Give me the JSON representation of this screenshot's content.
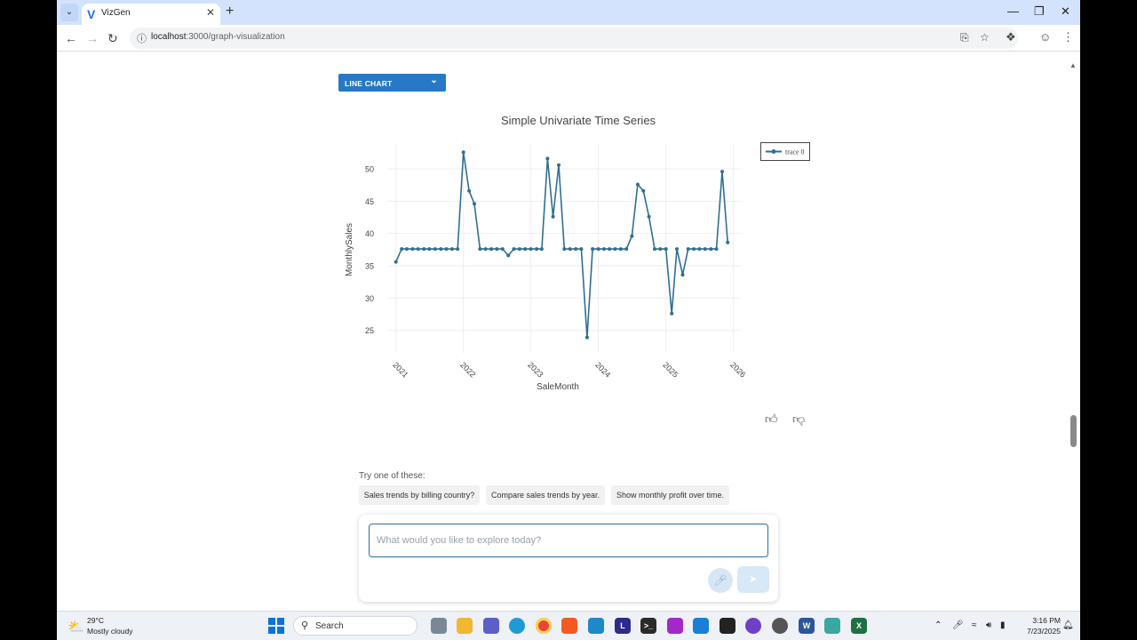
{
  "browser": {
    "tab_title": "VizGen",
    "tab_favicon": "V",
    "url_host": "localhost",
    "url_path": ":3000/graph-visualization"
  },
  "page": {
    "chart_selector_label": "LINE CHART",
    "suggestions_title": "Try one of these:",
    "suggestions": [
      "Sales trends by billing country?",
      "Compare sales trends by year.",
      "Show monthly profit over time."
    ],
    "query_placeholder": "What would you like to explore today?"
  },
  "colors": {
    "accent": "#2779c6",
    "series": "#2f6f92"
  },
  "chart_data": {
    "type": "line",
    "title": "Simple Univariate Time Series",
    "xlabel": "SaleMonth",
    "ylabel": "MonthlySales",
    "x_ticks": [
      "2021",
      "2022",
      "2023",
      "2024",
      "2025",
      "2026"
    ],
    "y_ticks": [
      25,
      30,
      35,
      40,
      45,
      50
    ],
    "ylim": [
      21.5,
      54
    ],
    "xlim": [
      "2020-11-20",
      "2026-02-10"
    ],
    "grid": true,
    "legend_position": "top-right",
    "series": [
      {
        "name": "trace 0",
        "x": [
          "2021-01",
          "2021-02",
          "2021-03",
          "2021-04",
          "2021-05",
          "2021-06",
          "2021-07",
          "2021-08",
          "2021-09",
          "2021-10",
          "2021-11",
          "2021-12",
          "2022-01",
          "2022-02",
          "2022-03",
          "2022-04",
          "2022-05",
          "2022-06",
          "2022-07",
          "2022-08",
          "2022-09",
          "2022-10",
          "2022-11",
          "2022-12",
          "2023-01",
          "2023-02",
          "2023-03",
          "2023-04",
          "2023-05",
          "2023-06",
          "2023-07",
          "2023-08",
          "2023-09",
          "2023-10",
          "2023-11",
          "2023-12",
          "2024-01",
          "2024-02",
          "2024-03",
          "2024-04",
          "2024-05",
          "2024-06",
          "2024-07",
          "2024-08",
          "2024-09",
          "2024-10",
          "2024-11",
          "2024-12",
          "2025-01",
          "2025-02",
          "2025-03",
          "2025-04",
          "2025-05",
          "2025-06",
          "2025-07",
          "2025-08",
          "2025-09",
          "2025-10",
          "2025-11",
          "2025-12"
        ],
        "values": [
          35.6,
          37.6,
          37.6,
          37.6,
          37.6,
          37.6,
          37.6,
          37.6,
          37.6,
          37.6,
          37.6,
          37.6,
          52.6,
          46.6,
          44.6,
          37.6,
          37.6,
          37.6,
          37.6,
          37.6,
          36.6,
          37.6,
          37.6,
          37.6,
          37.6,
          37.6,
          37.6,
          51.6,
          42.6,
          50.6,
          37.6,
          37.6,
          37.6,
          37.6,
          23.9,
          37.6,
          37.6,
          37.6,
          37.6,
          37.6,
          37.6,
          37.6,
          39.6,
          47.6,
          46.6,
          42.6,
          37.6,
          37.6,
          37.6,
          27.6,
          37.6,
          33.6,
          37.6,
          37.6,
          37.6,
          37.6,
          37.6,
          37.6,
          49.6,
          38.6
        ]
      }
    ]
  },
  "taskbar": {
    "weather_temp": "29°C",
    "weather_desc": "Mostly cloudy",
    "search_label": "Search",
    "time": "3:16 PM",
    "date": "7/23/2025"
  }
}
